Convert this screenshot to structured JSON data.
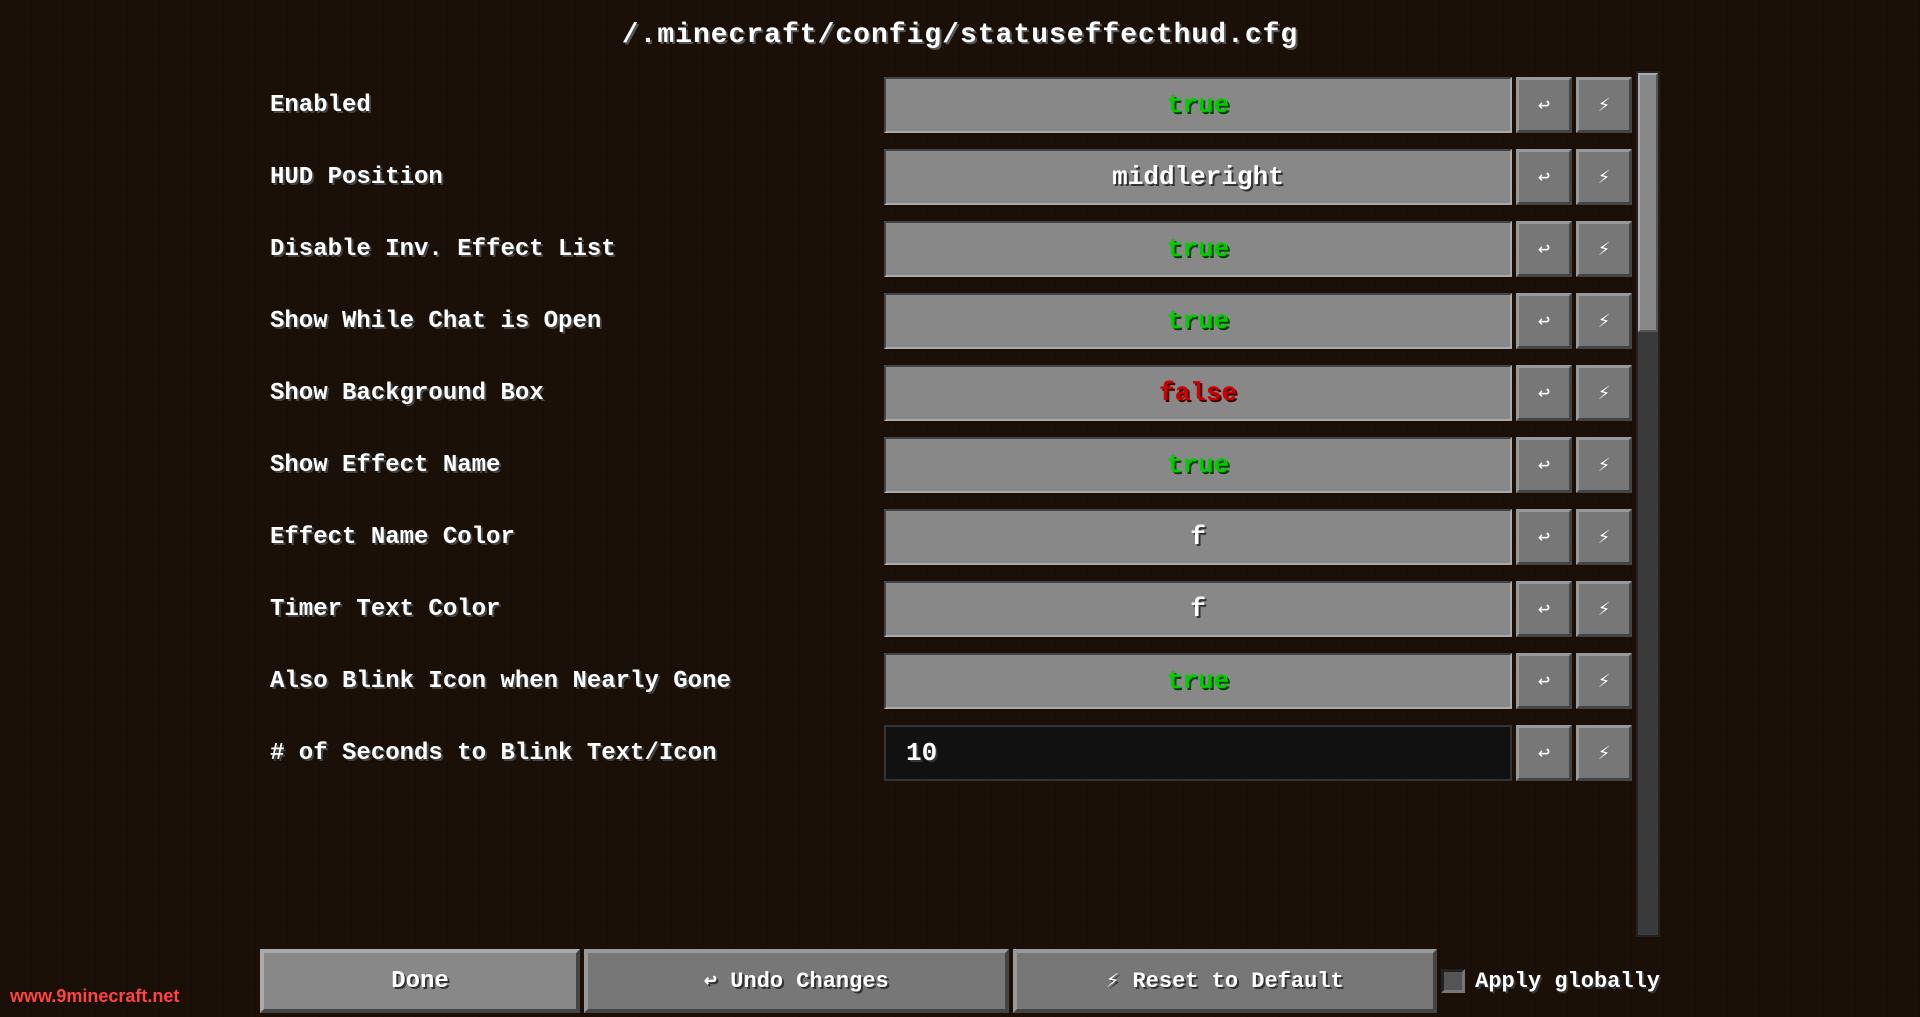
{
  "header": {
    "title": "/.minecraft/config/statuseffecthud.cfg"
  },
  "rows": [
    {
      "label": "Enabled",
      "value": "true",
      "valueType": "true"
    },
    {
      "label": "HUD Position",
      "value": "middleright",
      "valueType": "text"
    },
    {
      "label": "Disable Inv. Effect List",
      "value": "true",
      "valueType": "true"
    },
    {
      "label": "Show While Chat is Open",
      "value": "true",
      "valueType": "true"
    },
    {
      "label": "Show Background Box",
      "value": "false",
      "valueType": "false"
    },
    {
      "label": "Show Effect Name",
      "value": "true",
      "valueType": "true"
    },
    {
      "label": "Effect Name Color",
      "value": "f",
      "valueType": "text"
    },
    {
      "label": "Timer Text Color",
      "value": "f",
      "valueType": "text"
    },
    {
      "label": "Also Blink Icon when Nearly Gone",
      "value": "true",
      "valueType": "true"
    },
    {
      "label": "# of Seconds to Blink Text/Icon",
      "value": "10",
      "valueType": "number"
    }
  ],
  "buttons": {
    "undo_icon": "↩",
    "reset_icon": "⚡",
    "done_label": "Done",
    "undo_label": "↩ Undo Changes",
    "reset_label": "⚡ Reset to Default",
    "apply_label": "Apply globally"
  },
  "watermark": {
    "prefix": "www.",
    "name": "9minecraft",
    "suffix": ".net"
  }
}
